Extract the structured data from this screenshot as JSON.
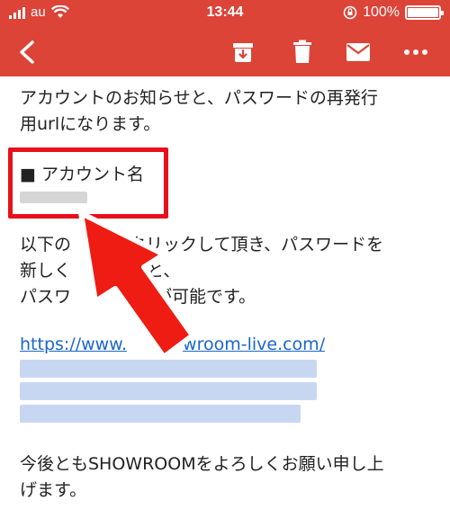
{
  "status": {
    "carrier": "au",
    "time": "13:44",
    "battery": "100%"
  },
  "toolbar": {
    "back_icon": "back-arrow-icon",
    "archive_icon": "archive-icon",
    "delete_icon": "trash-icon",
    "mark_unread_icon": "mail-icon",
    "more_icon": "more-dots-icon"
  },
  "email": {
    "intro_line1": "アカウントのお知らせと、パスワードの再発行",
    "intro_line2": "用urlになります。",
    "account_label": "■ アカウント名",
    "body_line1": "以下の",
    "body_line1b": "クリックして頂き、パスワードを",
    "body_line2": "新しく",
    "body_line2b": "と、",
    "body_line3": "パスワ",
    "body_line3b": "更が可能です。",
    "link_start": "https://www.",
    "link_end": "wroom-live.com/",
    "closing_line1": "今後ともSHOWROOMをよろしくお願い申し上",
    "closing_line2": "げます。"
  },
  "colors": {
    "header": "#db4437",
    "highlight": "#e8101c",
    "link": "#1a66c9"
  }
}
